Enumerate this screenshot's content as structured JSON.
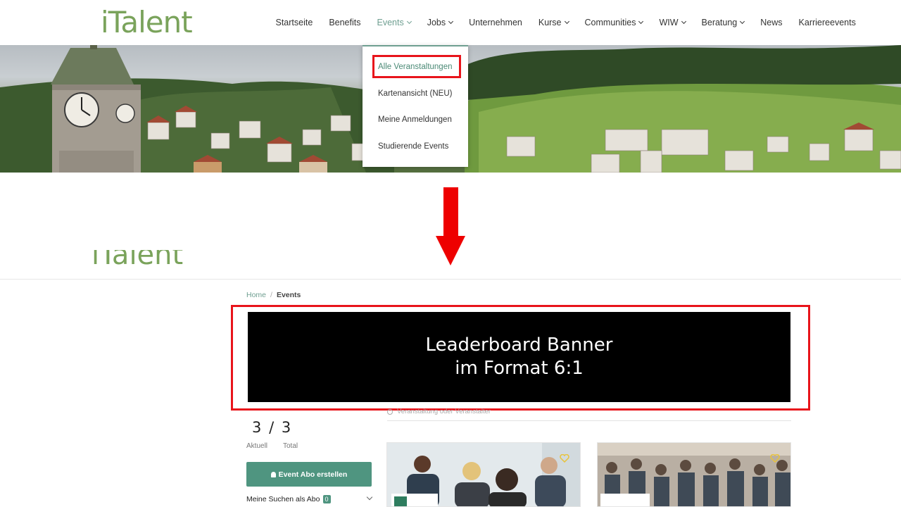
{
  "logo": {
    "text": "iTalent"
  },
  "nav": {
    "items": [
      {
        "label": "Startseite",
        "dropdown": false
      },
      {
        "label": "Benefits",
        "dropdown": false
      },
      {
        "label": "Events",
        "dropdown": true,
        "active": true
      },
      {
        "label": "Jobs",
        "dropdown": true
      },
      {
        "label": "Unternehmen",
        "dropdown": false
      },
      {
        "label": "Kurse",
        "dropdown": true
      },
      {
        "label": "Communities",
        "dropdown": true
      },
      {
        "label": "WIW",
        "dropdown": true
      },
      {
        "label": "Beratung",
        "dropdown": true
      },
      {
        "label": "News",
        "dropdown": false
      },
      {
        "label": "Karriereevents",
        "dropdown": false
      }
    ]
  },
  "events_dropdown": {
    "items": [
      "Alle Veranstaltungen",
      "Kartenansicht (NEU)",
      "Meine Anmeldungen",
      "Studierende Events"
    ],
    "highlighted": "Alle Veranstaltungen"
  },
  "page": {
    "logo_cut": "iTalent",
    "breadcrumb": {
      "home": "Home",
      "separator": "/",
      "current": "Events"
    },
    "banner": {
      "line1": "Leaderboard Banner",
      "line2": "im Format 6:1"
    },
    "search": {
      "placeholder": "Veranstaltung oder Veranstalter"
    },
    "counter": {
      "current": "3",
      "separator": "/",
      "total": "3",
      "current_label": "Aktuell",
      "total_label": "Total"
    },
    "abo_button": "Event Abo erstellen",
    "saved_searches": {
      "label": "Meine Suchen als Abo",
      "count": "0"
    }
  },
  "colors": {
    "brand_green": "#7aa35b",
    "teal": "#4f9580",
    "highlight_red": "#e8141b",
    "arrow_red": "#ee0000"
  },
  "icons": [
    "chevron-down-icon",
    "bell-icon",
    "search-icon",
    "heart-icon"
  ]
}
